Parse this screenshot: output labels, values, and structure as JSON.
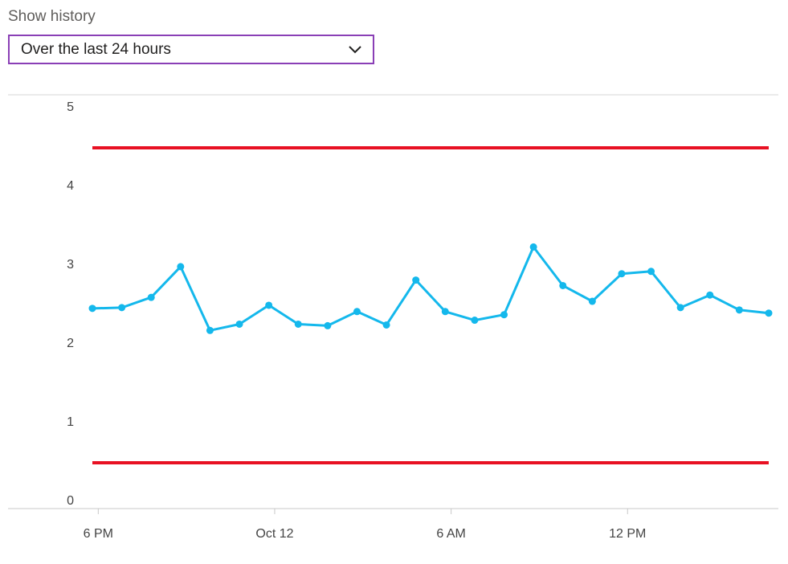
{
  "history": {
    "label": "Show history",
    "selected": "Over the last 24 hours"
  },
  "icons": {
    "dropdown": "chevron-down-icon"
  },
  "colors": {
    "series": "#14b8ec",
    "threshold": "#e81123",
    "selectBorder": "#8a3fb6"
  },
  "chart_data": {
    "type": "line",
    "title": "",
    "xlabel": "",
    "ylabel": "",
    "ylim": [
      0,
      5
    ],
    "yticks": [
      "0",
      "1",
      "2",
      "3",
      "4",
      "5"
    ],
    "xticks": [
      "6 PM",
      "Oct 12",
      "6 AM",
      "12 PM"
    ],
    "xtick_positions_hours": [
      0,
      6,
      12,
      18
    ],
    "xlim_hours": [
      -0.2,
      22.8
    ],
    "grid": false,
    "series": [
      {
        "x_hours": [
          -0.2,
          0.8,
          1.8,
          2.8,
          3.8,
          4.8,
          5.8,
          6.8,
          7.8,
          8.8,
          9.8,
          10.8,
          11.8,
          12.8,
          13.8,
          14.8,
          15.8,
          16.8,
          17.8,
          18.8,
          19.8,
          20.8,
          21.8,
          22.8
        ],
        "values": [
          2.43,
          2.44,
          2.57,
          2.96,
          2.15,
          2.23,
          2.47,
          2.23,
          2.21,
          2.39,
          2.22,
          2.79,
          2.39,
          2.28,
          2.35,
          3.21,
          2.72,
          2.52,
          2.87,
          2.9,
          2.44,
          2.6,
          2.41,
          2.37
        ]
      }
    ],
    "thresholds": [
      4.47,
      0.47
    ]
  }
}
